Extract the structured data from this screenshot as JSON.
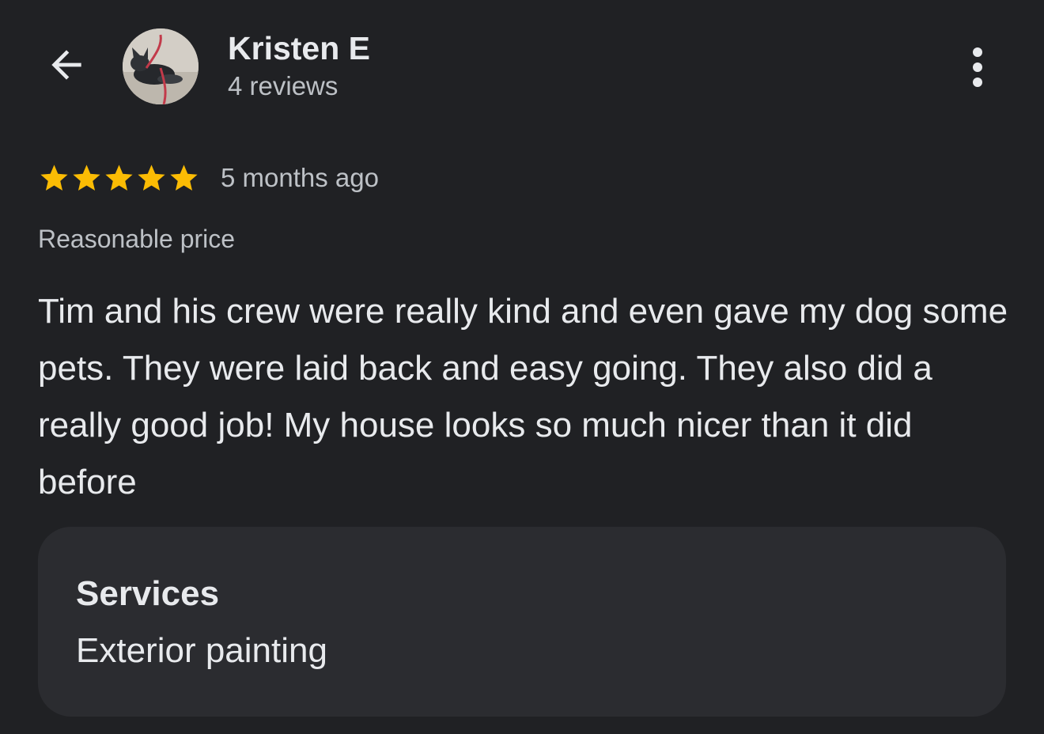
{
  "header": {
    "back_icon": "arrow-back-icon",
    "reviewer_name": "Kristen E",
    "reviewer_review_count": "4 reviews",
    "more_icon": "more-vert-icon"
  },
  "review": {
    "rating": 5,
    "rating_max": 5,
    "star_color": "#fbbc04",
    "date": "5 months ago",
    "attribute": "Reasonable price",
    "text": "Tim and his crew were really kind and even gave my dog some pets. They were laid back and easy going. They also did a really good job! My house looks so much nicer than it did before"
  },
  "services": {
    "title": "Services",
    "value": "Exterior painting"
  },
  "colors": {
    "background": "#202124",
    "card": "#2b2c30",
    "primary_text": "#e8eaed",
    "secondary_text": "#bdc1c6"
  }
}
